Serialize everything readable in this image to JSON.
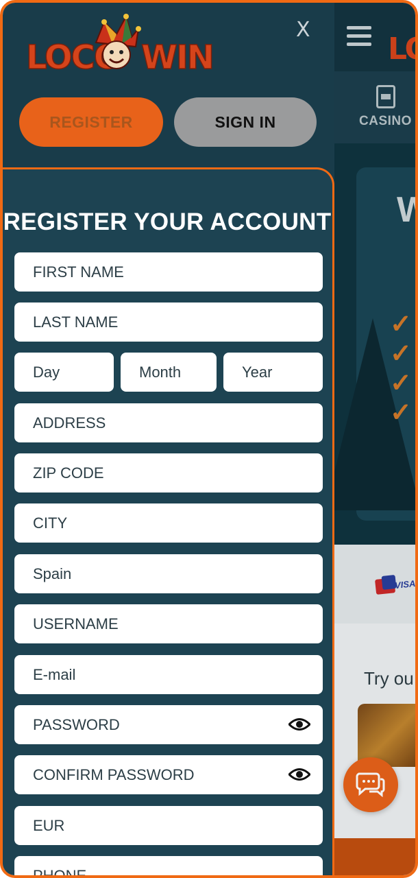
{
  "header": {
    "logo_left": "LOCO",
    "logo_right": "WIN",
    "close_label": "X",
    "register_label": "REGISTER",
    "signin_label": "SIGN IN"
  },
  "background": {
    "nav_label": "CASINO",
    "hero_letter": "W",
    "pay_label": "VISA",
    "promo_text": "Try ou"
  },
  "form": {
    "title": "REGISTER YOUR ACCOUNT",
    "first_name": "FIRST NAME",
    "last_name": "LAST NAME",
    "day": "Day",
    "month": "Month",
    "year": "Year",
    "address": "ADDRESS",
    "zip": "ZIP CODE",
    "city": "CITY",
    "country": "Spain",
    "username": "USERNAME",
    "email": "E-mail",
    "password": "PASSWORD",
    "confirm_password": "CONFIRM PASSWORD",
    "currency": "EUR",
    "phone": "PHONE"
  },
  "colors": {
    "accent": "#e8621a",
    "drawer": "#193c4a",
    "panel": "#1d4352"
  },
  "icons": [
    "hamburger-icon",
    "casino-icon",
    "close-icon",
    "eye-icon",
    "chat-icon",
    "check-icon"
  ]
}
